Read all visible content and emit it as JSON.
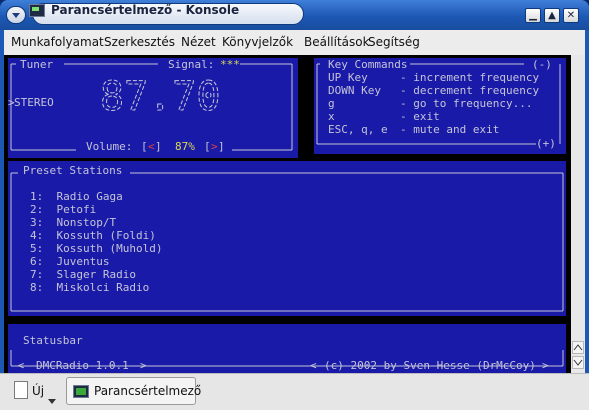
{
  "window": {
    "title": "Parancsértelmező - Konsole",
    "buttons": {
      "minimize": "▁",
      "maximize": "▲",
      "close": "✕"
    }
  },
  "menubar": [
    "Munkafolyamat",
    "Szerkesztés",
    "Nézet",
    "Könyvjelzők",
    "Beállítások",
    "Segítség"
  ],
  "tuner": {
    "title": "Tuner",
    "signal_label": "Signal:",
    "signal_value": "***",
    "mode": "STEREO",
    "mode_marker": ">",
    "big_frequency": "87.70",
    "volume_label": "Volume:",
    "volume_left": "<",
    "volume_value": "87%",
    "volume_right": ">"
  },
  "commands": {
    "title": "Key Commands",
    "collapse": "(-)",
    "expand": "(+)",
    "items": [
      {
        "key": "UP Key",
        "desc": "- increment frequency"
      },
      {
        "key": "DOWN Key",
        "desc": "- decrement frequency"
      },
      {
        "key": "g",
        "desc": "- go to frequency..."
      },
      {
        "key": "x",
        "desc": "- exit"
      },
      {
        "key": "ESC, q, e",
        "desc": "- mute and exit"
      }
    ]
  },
  "presets": {
    "title": "Preset Stations",
    "stations": [
      "1:  Radio Gaga",
      "2:  Petofi",
      "3:  Nonstop/T",
      "4:  Kossuth (Foldi)",
      "5:  Kossuth (Muhold)",
      "6:  Juventus",
      "7:  Slager Radio",
      "8:  Miskolci Radio"
    ]
  },
  "statusbar": {
    "title": "Statusbar",
    "app": "DMCRadio 1.0.1",
    "copyright": "(c) 2002 by Sven Hesse (DrMcCoy)"
  },
  "taskbar": {
    "new_label": "Új",
    "session_label": "Parancsértelmező"
  },
  "colors": {
    "terminal_blue": "#1a1aa8",
    "terminal_text": "#c4c4d8",
    "highlight": "#d8d854",
    "volume_arrow": "#e04040"
  }
}
